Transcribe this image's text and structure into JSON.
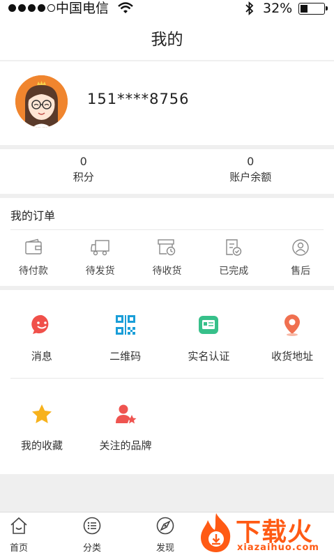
{
  "status_bar": {
    "carrier": "中国电信",
    "battery": "32%",
    "battery_level": 0.32
  },
  "header": {
    "title": "我的"
  },
  "profile": {
    "phone": "151****8756"
  },
  "stats": [
    {
      "value": "0",
      "label": "积分"
    },
    {
      "value": "0",
      "label": "账户余额"
    }
  ],
  "orders": {
    "title": "我的订单",
    "items": [
      {
        "label": "待付款",
        "icon": "wallet-icon"
      },
      {
        "label": "待发货",
        "icon": "truck-icon"
      },
      {
        "label": "待收货",
        "icon": "package-clock-icon"
      },
      {
        "label": "已完成",
        "icon": "check-document-icon"
      },
      {
        "label": "售后",
        "icon": "service-person-icon"
      }
    ]
  },
  "tools": [
    {
      "label": "消息",
      "icon": "message-icon",
      "color": "#f0504a"
    },
    {
      "label": "二维码",
      "icon": "qrcode-icon",
      "color": "#1a9ed8"
    },
    {
      "label": "实名认证",
      "icon": "id-card-icon",
      "color": "#37c08a"
    },
    {
      "label": "收货地址",
      "icon": "location-pin-icon",
      "color": "#f07050"
    },
    {
      "label": "我的收藏",
      "icon": "star-icon",
      "color": "#f7b21c"
    },
    {
      "label": "关注的品牌",
      "icon": "user-star-icon",
      "color": "#ef5450"
    }
  ],
  "tabbar": [
    {
      "label": "首页",
      "icon": "home-icon"
    },
    {
      "label": "分类",
      "icon": "list-icon"
    },
    {
      "label": "发现",
      "icon": "compass-icon"
    }
  ],
  "watermark": {
    "text": "下载火",
    "sub": "xiazaihuo.com"
  }
}
